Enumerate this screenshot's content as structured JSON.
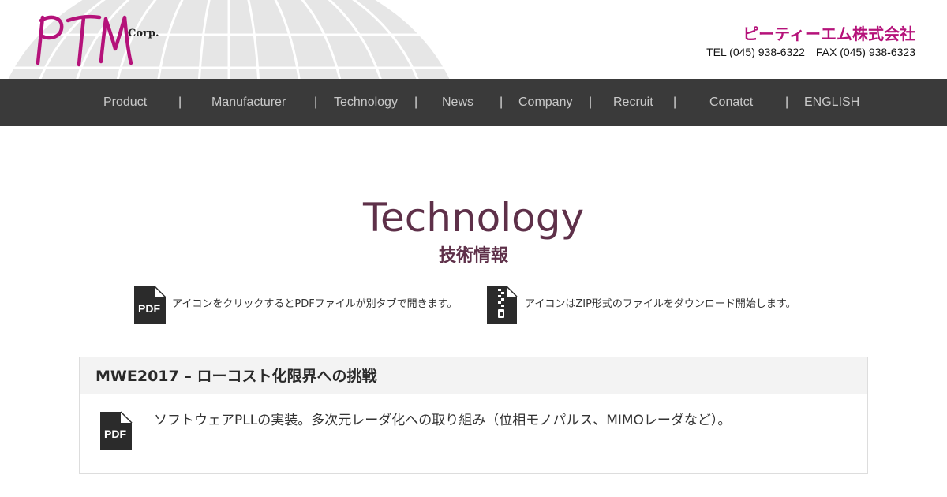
{
  "header": {
    "logo_text": "PTM",
    "logo_corp": "Corp.",
    "company_name": "ピーティーエム株式会社",
    "contact_line": "TEL (045) 938-6322　FAX (045) 938-6323"
  },
  "nav": {
    "items": [
      "Product",
      "Manufacturer",
      "Technology",
      "News",
      "Company",
      "Recruit",
      "Conatct",
      "ENGLISH"
    ],
    "separator": "|"
  },
  "main": {
    "title": "Technology",
    "subtitle": "技術情報"
  },
  "legend": {
    "pdf_icon_label": "PDF",
    "pdf_text": "アイコンをクリックするとPDFファイルが別タブで開きます。",
    "zip_text": "アイコンはZIP形式のファイルをダウンロード開始します。"
  },
  "entries": [
    {
      "title": "MWE2017 – ローコスト化限界への挑戦",
      "icon_label": "PDF",
      "description": "ソフトウェアPLLの実装。多次元レーダ化への取り組み（位相モノパルス、MIMOレーダなど）。"
    }
  ],
  "colors": {
    "brand_magenta": "#b5127a",
    "title_plum": "#5e3049",
    "nav_bg": "#3a3a3a",
    "nav_text": "#c9c9c9",
    "icon_dark": "#2b2b2b"
  },
  "icons": {
    "pdf": "pdf-file-icon",
    "zip": "zip-file-icon",
    "globe": "globe-grid-graphic"
  }
}
